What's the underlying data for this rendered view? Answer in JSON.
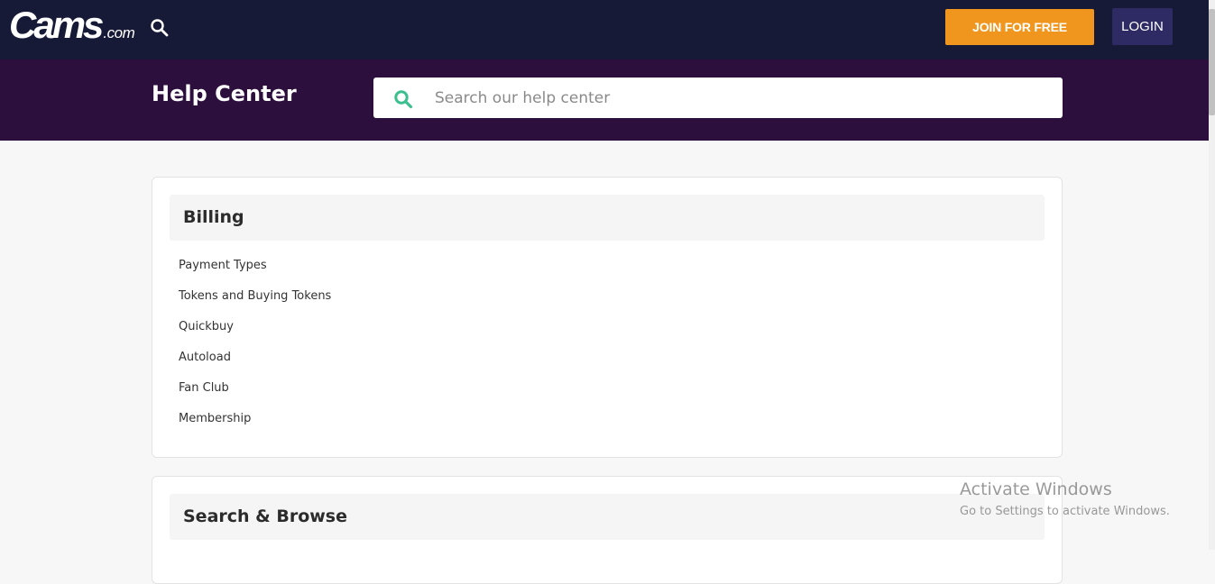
{
  "header": {
    "logo_main": "Cams",
    "logo_suffix": ".com",
    "join_label": "JOIN FOR FREE",
    "login_label": "LOGIN"
  },
  "hero": {
    "title": "Help Center",
    "search_placeholder": "Search our help center"
  },
  "sections": [
    {
      "title": "Billing",
      "links": [
        "Payment Types",
        "Tokens and Buying Tokens",
        "Quickbuy",
        "Autoload",
        "Fan Club",
        "Membership"
      ]
    },
    {
      "title": "Search & Browse",
      "links": []
    }
  ],
  "watermark": {
    "line1": "Activate Windows",
    "line2": "Go to Settings to activate Windows."
  },
  "colors": {
    "topbar": "#171a36",
    "hero": "#2c0f3d",
    "join": "#f0961e",
    "login": "#2e2a63",
    "search_icon": "#3cbf8f"
  },
  "icons": {
    "top_search": "search-icon",
    "hero_search": "search-icon"
  }
}
